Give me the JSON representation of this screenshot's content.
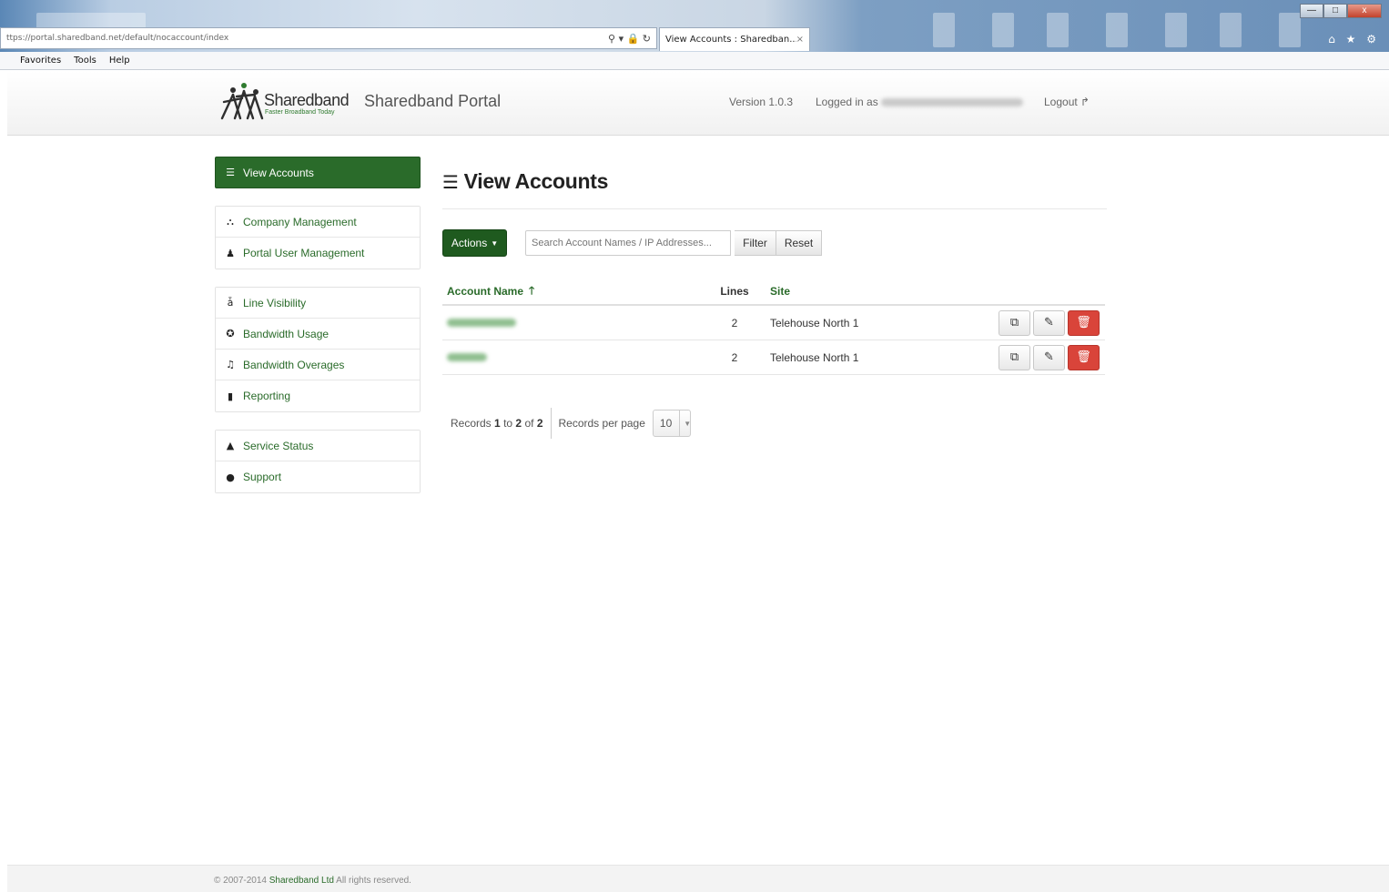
{
  "browser": {
    "url": "ttps://portal.sharedband.net/default/nocaccount/index",
    "addr_icons": "⚲ ▾ 🔒 ↻",
    "tab_title": "View Accounts : Sharedban...",
    "tab_close": "×",
    "win_min": "—",
    "win_max": "□",
    "win_close": "x",
    "right_icons": "⌂ ★ ⚙",
    "menu": [
      "Favorites",
      "Tools",
      "Help"
    ]
  },
  "header": {
    "logo_name": "Sharedband",
    "logo_tagline": "Faster Broadband Today",
    "portal_name": "Sharedband Portal",
    "version": "Version 1.0.3",
    "logged_in_label": "Logged in as",
    "logout": "Logout"
  },
  "sidebar": {
    "active": {
      "label": "View Accounts",
      "icon": "list-icon"
    },
    "groups": [
      [
        {
          "label": "Company Management",
          "icon": "sitemap-icon"
        },
        {
          "label": "Portal User Management",
          "icon": "user-icon"
        }
      ],
      [
        {
          "label": "Line Visibility",
          "icon": "rss-icon"
        },
        {
          "label": "Bandwidth Usage",
          "icon": "dashboard-icon"
        },
        {
          "label": "Bandwidth Overages",
          "icon": "bell-icon"
        },
        {
          "label": "Reporting",
          "icon": "book-icon"
        }
      ],
      [
        {
          "label": "Service Status",
          "icon": "warning-icon"
        },
        {
          "label": "Support",
          "icon": "comments-icon"
        }
      ]
    ]
  },
  "main": {
    "title": "View Accounts",
    "actions_label": "Actions",
    "search_placeholder": "Search Account Names / IP Addresses...",
    "filter_label": "Filter",
    "reset_label": "Reset",
    "columns": {
      "name": "Account Name",
      "lines": "Lines",
      "site": "Site"
    },
    "rows": [
      {
        "lines": "2",
        "site": "Telehouse North 1"
      },
      {
        "lines": "2",
        "site": "Telehouse North 1"
      }
    ],
    "pager": {
      "records_prefix": "Records",
      "from": "1",
      "to_word": "to",
      "to": "2",
      "of_word": "of",
      "total": "2",
      "per_page_label": "Records per page",
      "per_page_value": "10"
    }
  },
  "footer": {
    "copyright": "© 2007-2014",
    "company": "Sharedband Ltd",
    "rights": "All rights reserved."
  },
  "colors": {
    "brand_green": "#2a6b2a",
    "danger_red": "#d9443a"
  }
}
